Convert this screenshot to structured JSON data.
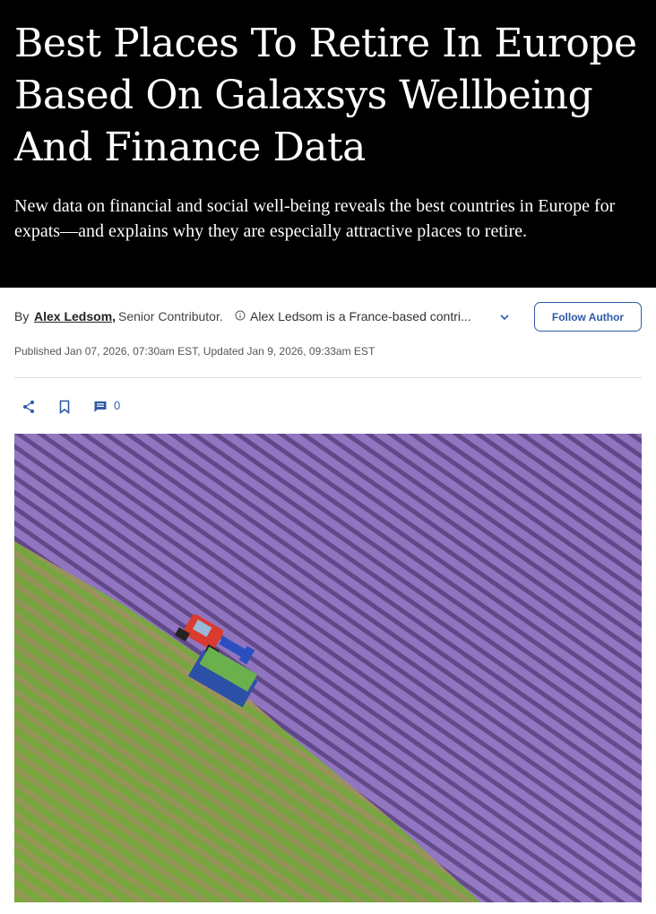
{
  "article": {
    "title": "Best Places To Retire In Europe Based On Galaxsys Wellbeing And Finance Data",
    "dek": "New data on financial and social well-being reveals the best countries in Europe for expats—and explains why they are especially attractive places to retire."
  },
  "byline": {
    "by": "By",
    "author": "Alex Ledsom,",
    "role": "Senior Contributor.",
    "bio": "Alex Ledsom is a France-based contri...",
    "follow_label": "Follow Author"
  },
  "dates": "Published Jan 07, 2026, 07:30am EST, Updated Jan 9, 2026, 09:33am EST",
  "actions": {
    "comment_count": "0"
  },
  "colors": {
    "accent": "#2f5aa8",
    "hero_bg": "#000000"
  },
  "image": {
    "alt_subject": "aerial view of lavender field harvest"
  }
}
